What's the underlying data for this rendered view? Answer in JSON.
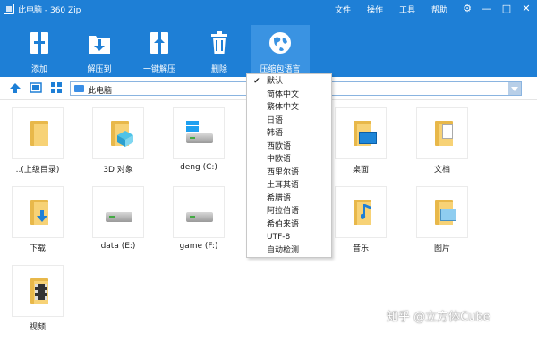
{
  "window": {
    "title": "此电脑 - 360 Zip",
    "menu": [
      "文件",
      "操作",
      "工具",
      "帮助"
    ],
    "controls": {
      "settings": "⚙",
      "minimize": "—",
      "maximize": "□",
      "close": "✕"
    }
  },
  "toolbar": {
    "add": "添加",
    "extract_to": "解压到",
    "one_click_extract": "一键解压",
    "delete": "删除",
    "archive_language": "压缩包语言"
  },
  "address": {
    "path": "此电脑"
  },
  "files": [
    {
      "name": "..(上级目录)",
      "icon": "folder-icon"
    },
    {
      "name": "3D 对象",
      "icon": "3d-objects-icon"
    },
    {
      "name": "deng (C:)",
      "icon": "windows-drive-icon"
    },
    {
      "name": "桌面",
      "icon": "desktop-folder-icon"
    },
    {
      "name": "文档",
      "icon": "documents-folder-icon"
    },
    {
      "name": "下载",
      "icon": "downloads-folder-icon"
    },
    {
      "name": "data (E:)",
      "icon": "drive-icon"
    },
    {
      "name": "game (F:)",
      "icon": "drive-icon"
    },
    {
      "name": "音乐",
      "icon": "music-folder-icon"
    },
    {
      "name": "图片",
      "icon": "pictures-folder-icon"
    },
    {
      "name": "视频",
      "icon": "videos-folder-icon"
    }
  ],
  "language_menu": {
    "selected": "默认",
    "items": [
      "默认",
      "简体中文",
      "繁体中文",
      "日语",
      "韩语",
      "西欧语",
      "中欧语",
      "西里尔语",
      "土耳其语",
      "希腊语",
      "阿拉伯语",
      "希伯来语",
      "UTF-8",
      "自动检测"
    ]
  },
  "watermark": "知乎 @立方体Cube",
  "colors": {
    "accent": "#1e7fd6",
    "active_tool": "#3a93e2",
    "folder": "#f7d276"
  }
}
